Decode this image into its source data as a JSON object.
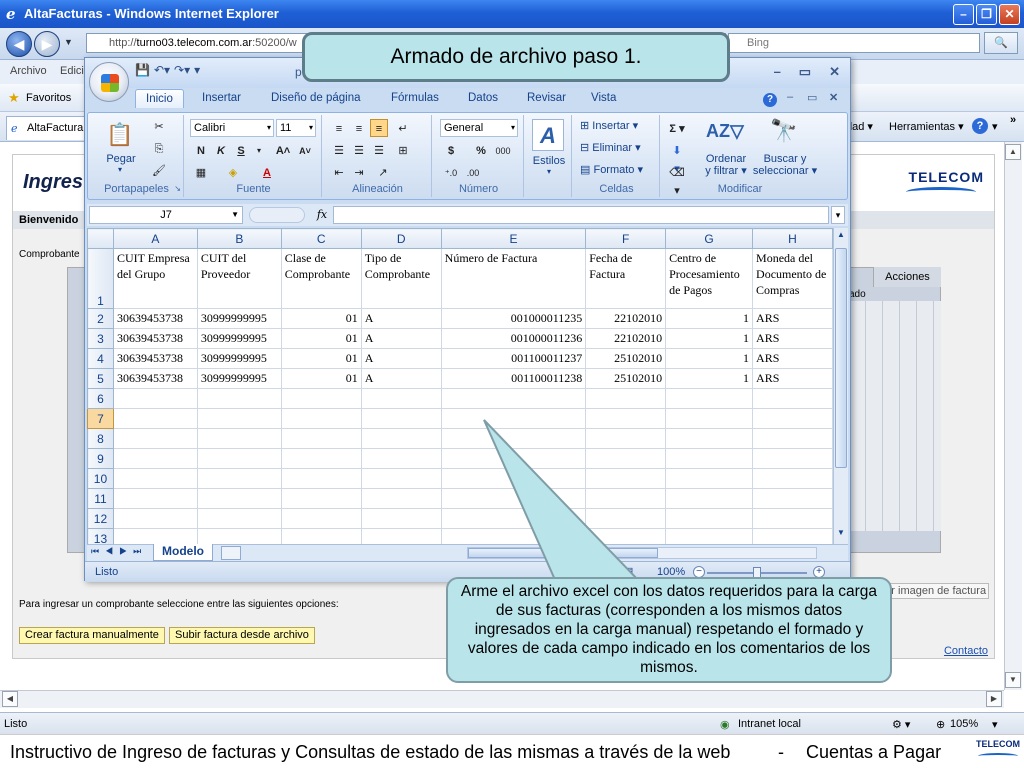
{
  "ie": {
    "title": "AltaFacturas - Windows Internet Explorer",
    "url_prefix": "http://",
    "url_host": "turno03.telecom.com.ar",
    "url_rest": ":50200/w",
    "search_placeholder": "Bing",
    "menu_archivo": "Archivo",
    "menu_edicion": "Edici",
    "favoritos": "Favoritos",
    "tab_label": "AltaFactura",
    "tools_dad": "dad",
    "tools_herramientas": "Herramientas",
    "status_listo": "Listo",
    "status_zone": "Intranet local",
    "status_zoom": "105%"
  },
  "page": {
    "heading": "Ingres",
    "logo": "TELECOM",
    "bienvenido": "Bienvenido",
    "comprobante": "Comprobante",
    "acciones": "Acciones",
    "ado": "ado",
    "adjuntar": "Adjuntar imagen de factura",
    "opciones": "Para ingresar un comprobante seleccione entre las siguientes opciones:",
    "btn_manual": "Crear factura manualmente",
    "btn_archivo": "Subir factura desde archivo",
    "contacto": "Contacto"
  },
  "excel": {
    "title_partial": "p",
    "tabs": [
      "Inicio",
      "Insertar",
      "Diseño de página",
      "Fórmulas",
      "Datos",
      "Revisar",
      "Vista"
    ],
    "groups": {
      "portapapeles": "Portapapeles",
      "fuente": "Fuente",
      "alineacion": "Alineación",
      "numero": "Número",
      "celdas": "Celdas",
      "modificar": "Modificar"
    },
    "pegar": "Pegar",
    "font_name": "Calibri",
    "font_size": "11",
    "number_format": "General",
    "estilos": "Estilos",
    "insertar": "Insertar",
    "eliminar": "Eliminar",
    "formato": "Formato",
    "ordenar_1": "Ordenar",
    "ordenar_2": "y filtrar",
    "buscar_1": "Buscar y",
    "buscar_2": "seleccionar",
    "namebox": "J7",
    "fx": "fx",
    "columns": [
      "A",
      "B",
      "C",
      "D",
      "E",
      "F",
      "G",
      "H"
    ],
    "headers": [
      "CUIT Empresa del Grupo",
      "CUIT del Proveedor",
      "Clase de Comprobante",
      "Tipo de Comprobante",
      "Número de Factura",
      "Fecha de Factura",
      "Centro de Procesamiento de Pagos",
      "Moneda del Documento de Compras"
    ],
    "rows": [
      [
        "30639453738",
        "30999999995",
        "01",
        "A",
        "001000011235",
        "22102010",
        "1",
        "ARS"
      ],
      [
        "30639453738",
        "30999999995",
        "01",
        "A",
        "001000011236",
        "22102010",
        "1",
        "ARS"
      ],
      [
        "30639453738",
        "30999999995",
        "01",
        "A",
        "001100011237",
        "25102010",
        "1",
        "ARS"
      ],
      [
        "30639453738",
        "30999999995",
        "01",
        "A",
        "001100011238",
        "25102010",
        "1",
        "ARS"
      ]
    ],
    "row_numbers": [
      "1",
      "2",
      "3",
      "4",
      "5",
      "6",
      "7",
      "8",
      "9",
      "10",
      "11",
      "12",
      "13"
    ],
    "sheet_tab": "Modelo",
    "status": "Listo",
    "zoom": "100%"
  },
  "callouts": {
    "top": "Armado de archivo paso 1.",
    "bottom": "Arme el archivo excel con los datos requeridos para la carga de sus facturas (corresponden a los mismos datos ingresados en la carga manual) respetando el formado  y valores de cada campo indicado en los comentarios de los mismos."
  },
  "footer": {
    "text": "Instructivo de Ingreso de facturas y Consultas de estado de las mismas a través de la web",
    "sep": "-",
    "cuentas": "Cuentas a Pagar",
    "logo": "TELECOM"
  }
}
